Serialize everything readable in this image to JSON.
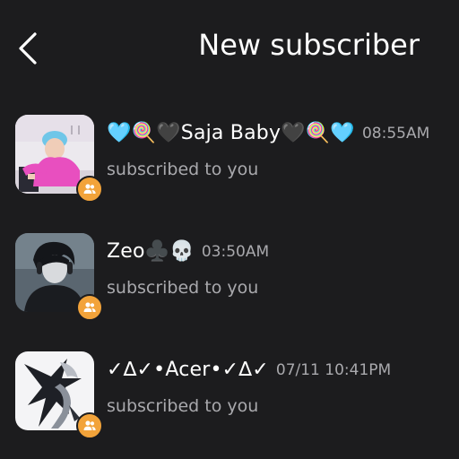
{
  "header": {
    "title": "New subscriber",
    "back_icon": "chevron-left-icon"
  },
  "badge_icon": "people-icon",
  "colors": {
    "background": "#1c1c1e",
    "badge": "#f2a33a",
    "secondary_text": "#a9a9ad"
  },
  "subscribers": [
    {
      "name": "🩵🍭🖤Saja Baby🖤🍭🩵",
      "time": "08:55AM",
      "action": "subscribed to you"
    },
    {
      "name": "Zeo♣️💀",
      "time": "03:50AM",
      "action": "subscribed to you"
    },
    {
      "name": "✓∆✓•Acer•✓∆✓",
      "time": "07/11 10:41PM",
      "action": "subscribed to you"
    }
  ]
}
